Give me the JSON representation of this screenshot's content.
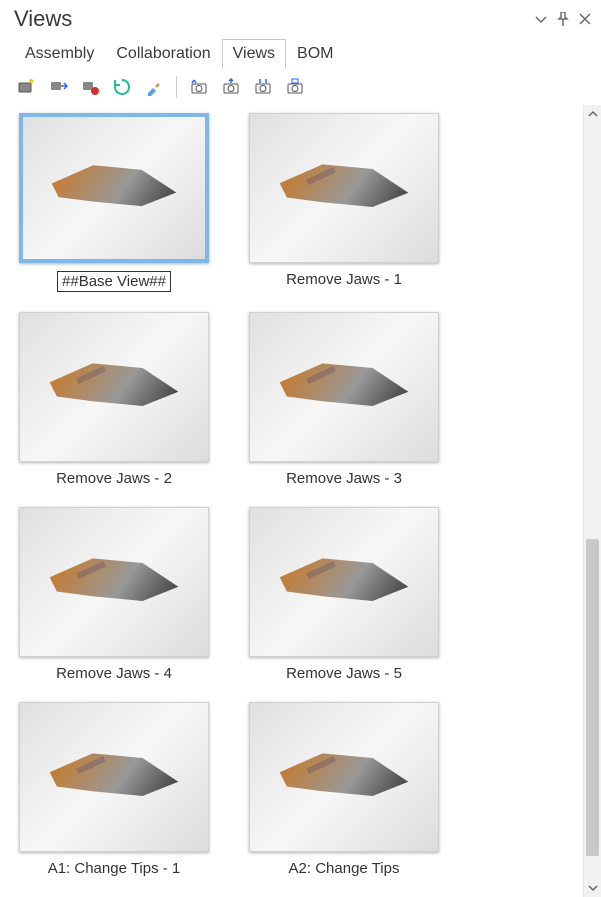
{
  "panel": {
    "title": "Views"
  },
  "window_controls": {
    "collapse_tooltip": "▼",
    "pin_tooltip": "📌",
    "close_tooltip": "✕"
  },
  "tabs": [
    {
      "label": "Assembly",
      "active": false
    },
    {
      "label": "Collaboration",
      "active": false
    },
    {
      "label": "Views",
      "active": true
    },
    {
      "label": "BOM",
      "active": false
    }
  ],
  "toolbar": {
    "icons_left": [
      "new-view",
      "move-view",
      "record-view",
      "refresh-view",
      "brush-view"
    ],
    "icons_right": [
      "camera-1",
      "camera-2",
      "camera-3",
      "camera-4"
    ]
  },
  "views": [
    {
      "label": "##Base View##",
      "selected": true,
      "editing": true
    },
    {
      "label": "Remove Jaws - 1",
      "selected": false,
      "editing": false
    },
    {
      "label": "Remove Jaws - 2",
      "selected": false,
      "editing": false
    },
    {
      "label": "Remove Jaws - 3",
      "selected": false,
      "editing": false
    },
    {
      "label": "Remove Jaws - 4",
      "selected": false,
      "editing": false
    },
    {
      "label": "Remove Jaws - 5",
      "selected": false,
      "editing": false
    },
    {
      "label": "A1: Change Tips - 1",
      "selected": false,
      "editing": false
    },
    {
      "label": "A2: Change Tips",
      "selected": false,
      "editing": false
    }
  ]
}
